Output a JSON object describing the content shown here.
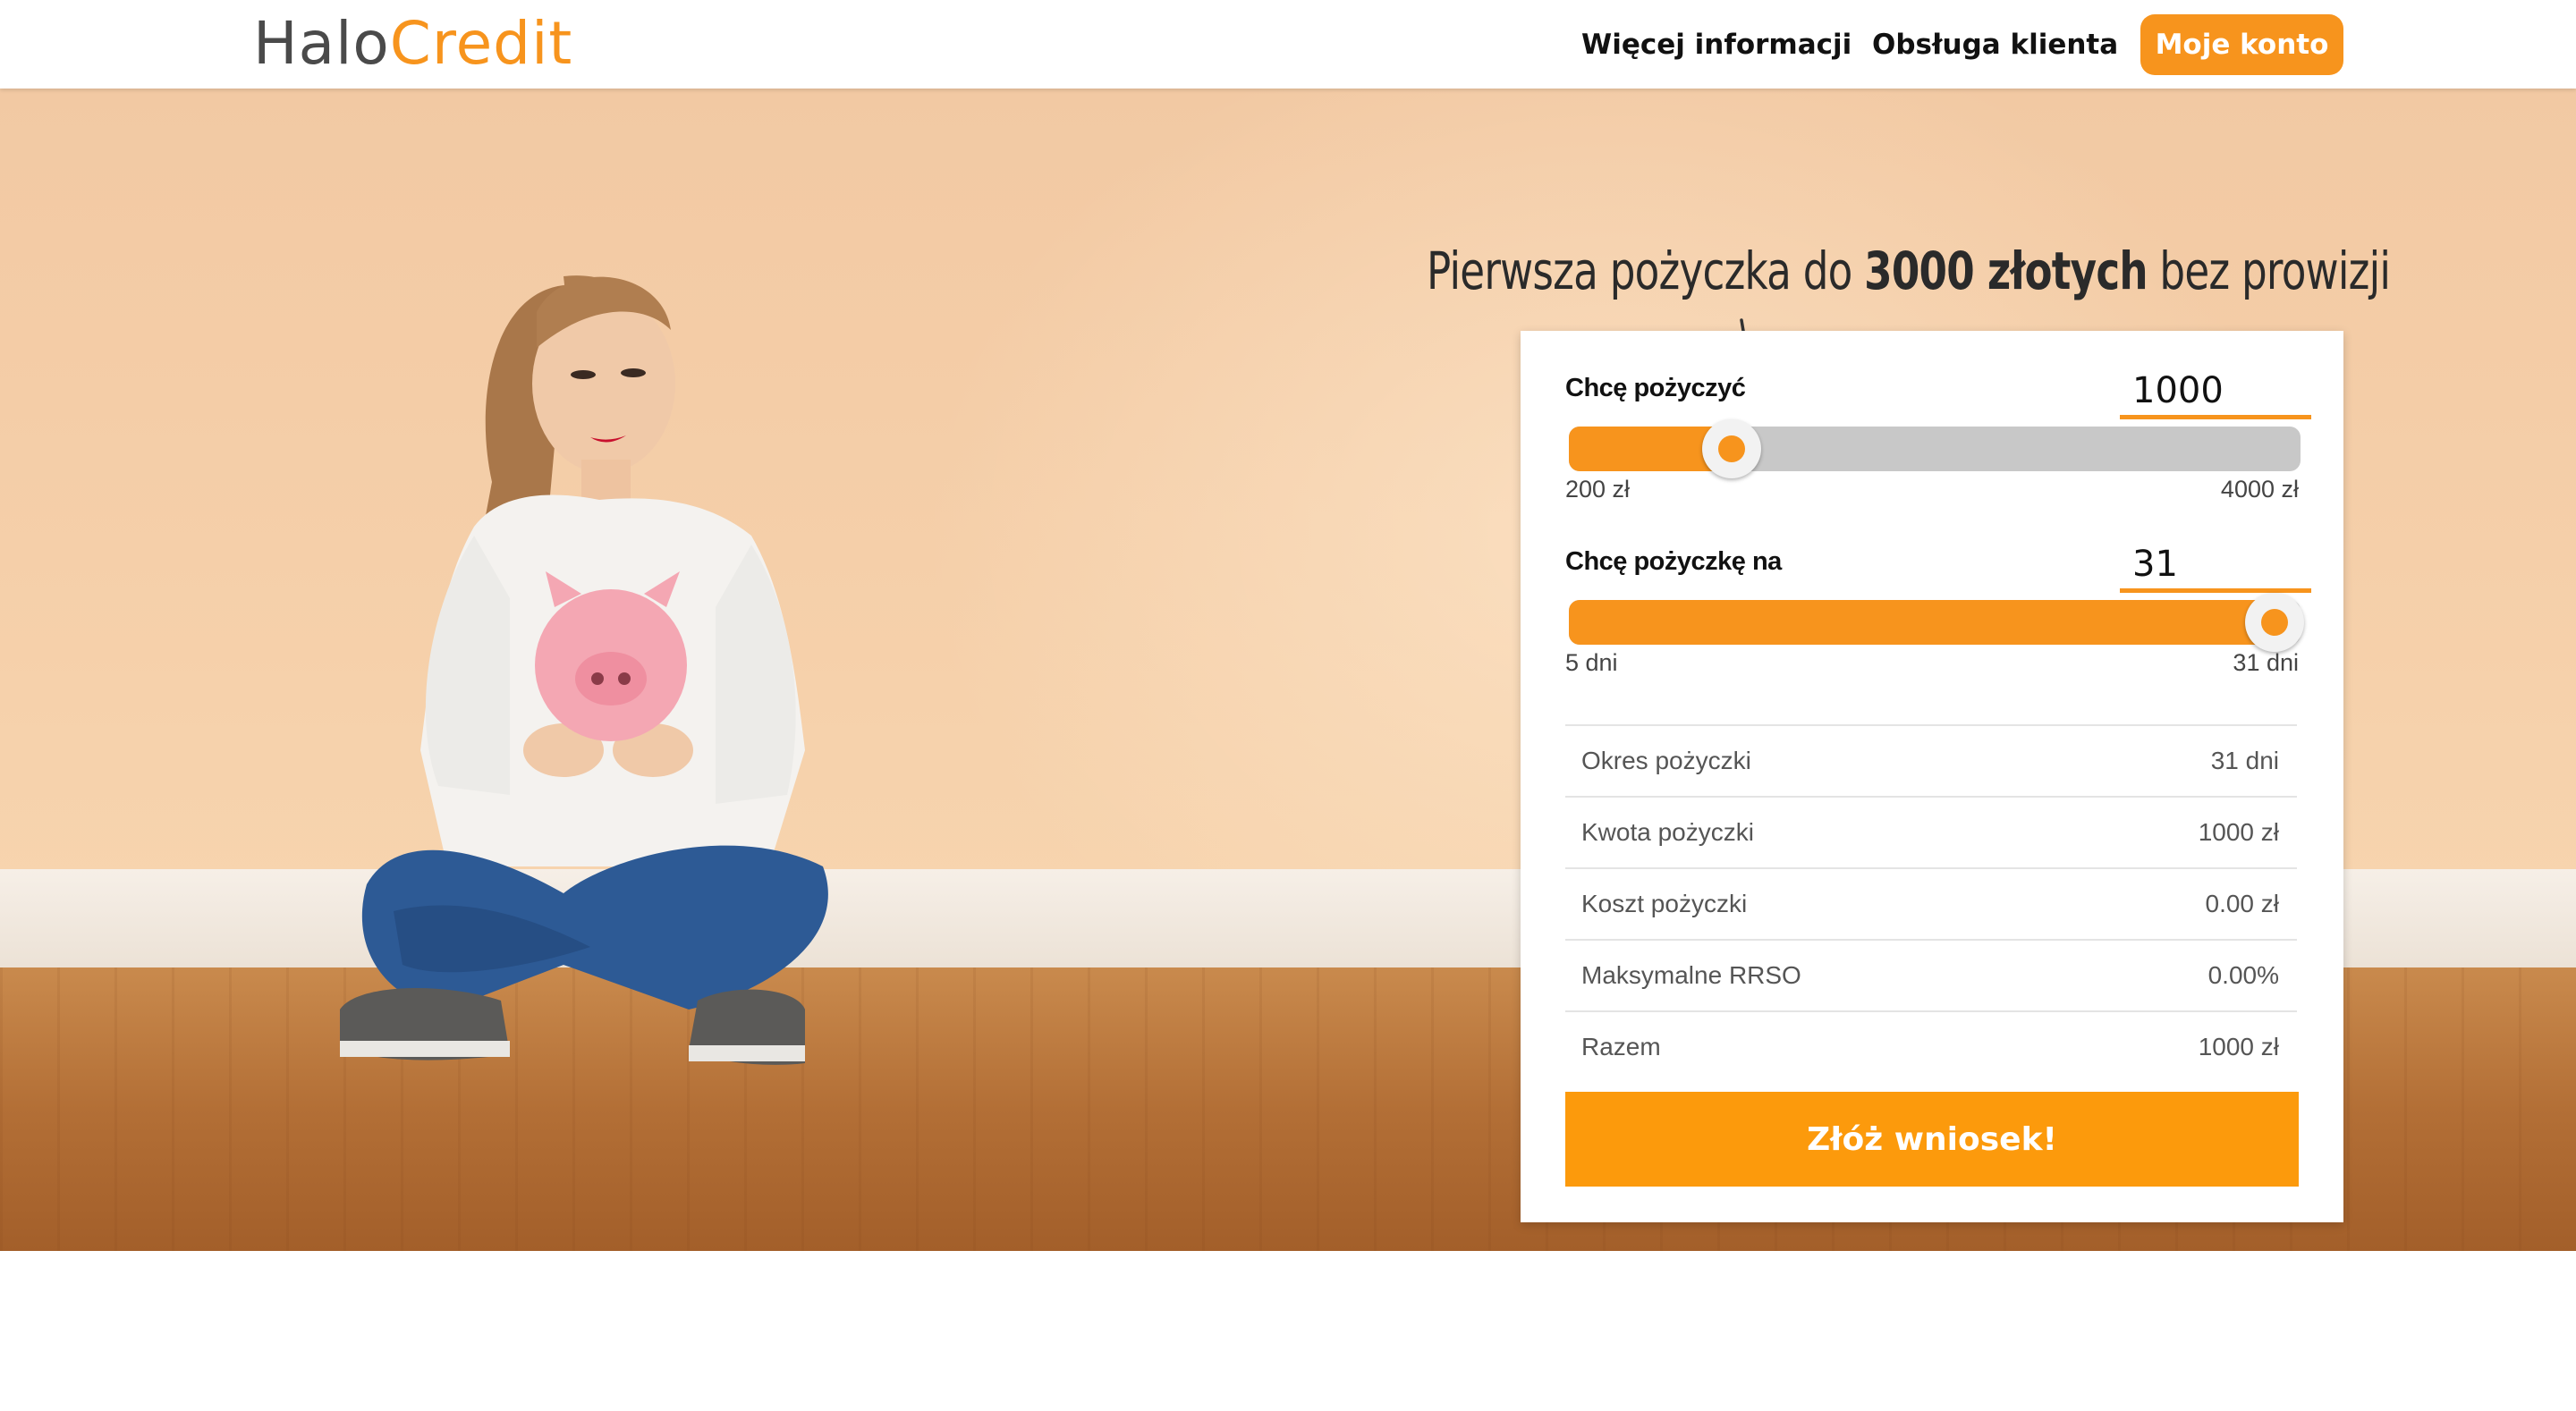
{
  "header": {
    "logo_part1": "Halo",
    "logo_part2": "Credit",
    "nav_more": "Więcej informacji",
    "nav_support": "Obsługa klienta",
    "account_button": "Moje konto"
  },
  "hero": {
    "headline_pre": "Pierwsza pożyczka do ",
    "headline_bold": "3000 złotych",
    "headline_post": " bez prowizji"
  },
  "calculator": {
    "amount": {
      "label": "Chcę pożyczyć",
      "value": "1000",
      "min_label": "200 zł",
      "max_label": "4000 zł",
      "min": 200,
      "max": 4000,
      "current": 1000
    },
    "period": {
      "label": "Chcę pożyczkę na",
      "value": "31",
      "min_label": "5 dni",
      "max_label": "31 dni",
      "min": 5,
      "max": 31,
      "current": 31
    },
    "summary": [
      {
        "label": "Okres pożyczki",
        "value": "31 dni"
      },
      {
        "label": "Kwota pożyczki",
        "value": "1000 zł"
      },
      {
        "label": "Koszt pożyczki",
        "value": "0.00 zł"
      },
      {
        "label": "Maksymalne RRSO",
        "value": "0.00%"
      },
      {
        "label": "Razem",
        "value": "1000 zł"
      }
    ],
    "submit_label": "Złóż wniosek!"
  },
  "colors": {
    "accent": "#f7941d",
    "button": "#fc9a0c"
  }
}
